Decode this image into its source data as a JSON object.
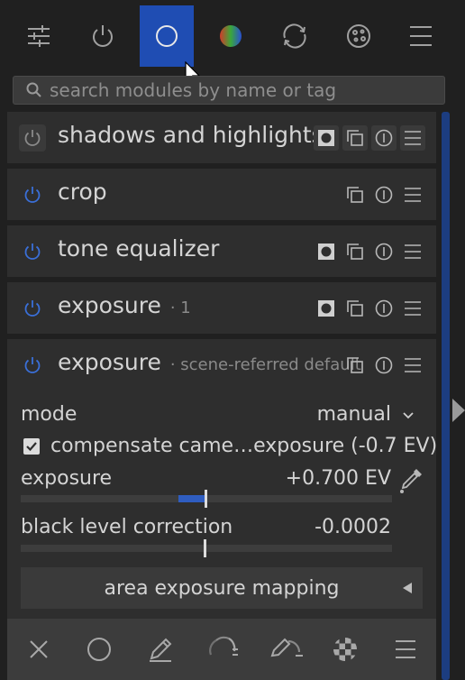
{
  "tabs": [
    {
      "icon": "sliders-icon",
      "active": false
    },
    {
      "icon": "power-icon",
      "active": false
    },
    {
      "icon": "circle-icon",
      "active": true
    },
    {
      "icon": "color-icon",
      "active": false
    },
    {
      "icon": "refresh-icon",
      "active": false
    },
    {
      "icon": "palette-icon",
      "active": false
    },
    {
      "icon": "hamburger-icon",
      "active": false
    }
  ],
  "search": {
    "placeholder": "search modules by name or tag"
  },
  "modules": [
    {
      "name": "shadows and highlights",
      "instance": "",
      "enabled": false
    },
    {
      "name": "crop",
      "instance": "",
      "enabled": true
    },
    {
      "name": "tone equalizer",
      "instance": "",
      "enabled": true
    },
    {
      "name": "exposure",
      "instance": "· 1",
      "enabled": true
    }
  ],
  "expanded_module": {
    "name": "exposure",
    "instance": "· scene-referred default",
    "enabled": true,
    "mode_label": "mode",
    "mode_value": "manual",
    "compensate_label": "compensate came…exposure (-0.7 EV)",
    "compensate_checked": true,
    "exposure_label": "exposure",
    "exposure_value": "+0.700 EV",
    "exposure_fraction": 0.7,
    "black_label": "black level correction",
    "black_value": "-0.0002",
    "area_button": "area exposure mapping"
  },
  "bottom_toolbar": [
    "close-icon",
    "circle-icon",
    "pencil-icon",
    "gradient-icon",
    "pencil-gradient-icon",
    "checker-icon",
    "menu-icon"
  ],
  "colors": {
    "accent": "#1f4db3",
    "power_on": "#3a6fd8",
    "background": "#202020"
  }
}
